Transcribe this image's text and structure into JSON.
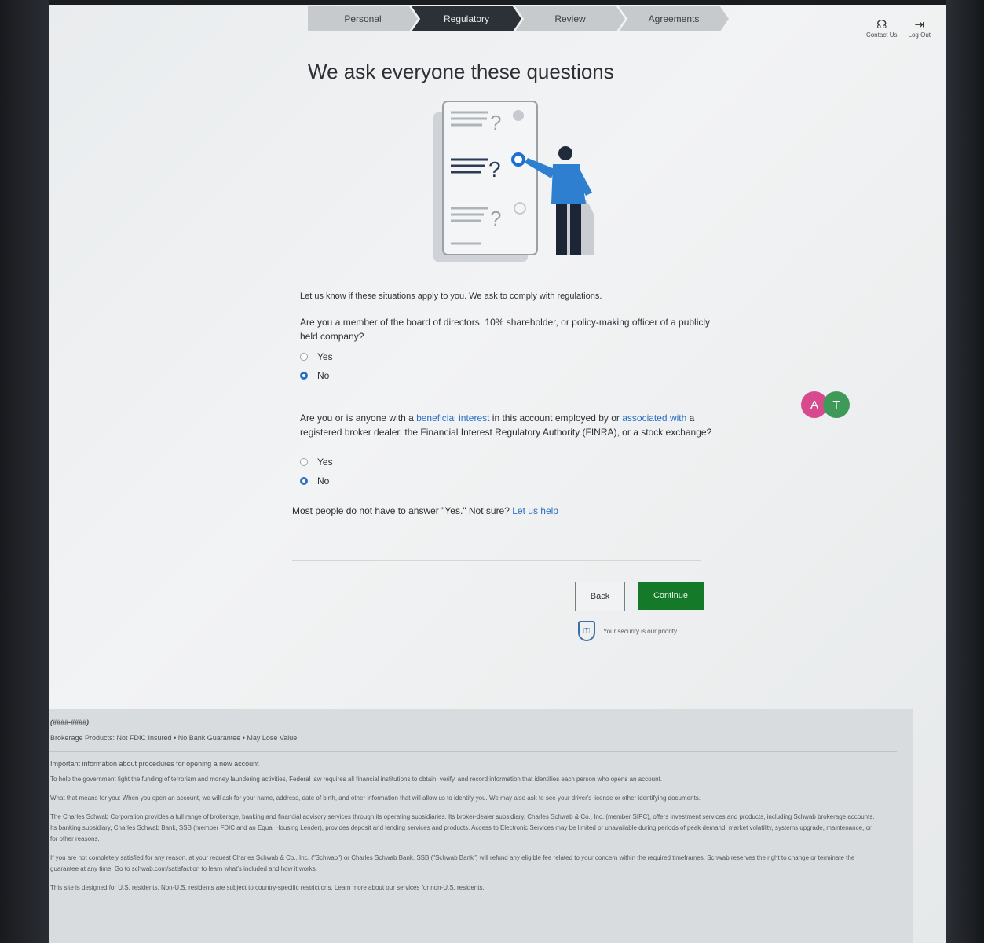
{
  "steps": [
    "Personal",
    "Regulatory",
    "Review",
    "Agreements"
  ],
  "active_step": 1,
  "header": {
    "contact_label": "Contact Us",
    "logout_label": "Log Out"
  },
  "main": {
    "title": "We ask everyone these questions",
    "intro": "Let us know if these situations apply to you. We ask to comply with regulations.",
    "q1": "Are you a member of the board of directors, 10% shareholder, or policy-making officer of a publicly held company?",
    "q2_part1": "Are you or is anyone with a ",
    "q2_link1": "beneficial interest",
    "q2_part2": " in this account employed by or ",
    "q2_link2": "associated with",
    "q2_part3": " a registered broker dealer, the Financial Interest Regulatory Authority (FINRA), or a stock exchange?",
    "yes_label": "Yes",
    "no_label": "No",
    "hint_text": "Most people do not have to answer \"Yes.\" Not sure?",
    "hint_link": "Let us help",
    "back_label": "Back",
    "continue_label": "Continue",
    "security_text": "Your security is our priority"
  },
  "avatars": [
    "A",
    "T"
  ],
  "footer": {
    "code": "(####-####)",
    "products": "Brokerage Products: Not FDIC Insured • No Bank Guarantee • May Lose Value",
    "important": "Important information about procedures for opening a new account",
    "p1": "To help the government fight the funding of terrorism and money laundering activities, Federal law requires all financial institutions to obtain, verify, and record information that identifies each person who opens an account.",
    "p2": "What that means for you: When you open an account, we will ask for your name, address, date of birth, and other information that will allow us to identify you. We may also ask to see your driver's license or other identifying documents.",
    "p3": "The Charles Schwab Corporation provides a full range of brokerage, banking and financial advisory services through its operating subsidiaries. Its broker-dealer subsidiary, Charles Schwab & Co., Inc. (member SIPC), offers investment services and products, including Schwab brokerage accounts. Its banking subsidiary, Charles Schwab Bank, SSB (member FDIC and an Equal Housing Lender), provides deposit and lending services and products. Access to Electronic Services may be limited or unavailable during periods of peak demand, market volatility, systems upgrade, maintenance, or for other reasons.",
    "p4": "If you are not completely satisfied for any reason, at your request Charles Schwab & Co., Inc. (\"Schwab\") or Charles Schwab Bank, SSB (\"Schwab Bank\") will refund any eligible fee related to your concern within the required timeframes. Schwab reserves the right to change or terminate the guarantee at any time. Go to schwab.com/satisfaction to learn what's included and how it works.",
    "p5": "This site is designed for U.S. residents. Non-U.S. residents are subject to country-specific restrictions. Learn more about our services for non-U.S. residents."
  },
  "colors": {
    "accent": "#2a6fc2",
    "continue": "#147a2a",
    "active_step": "#2b3137"
  }
}
